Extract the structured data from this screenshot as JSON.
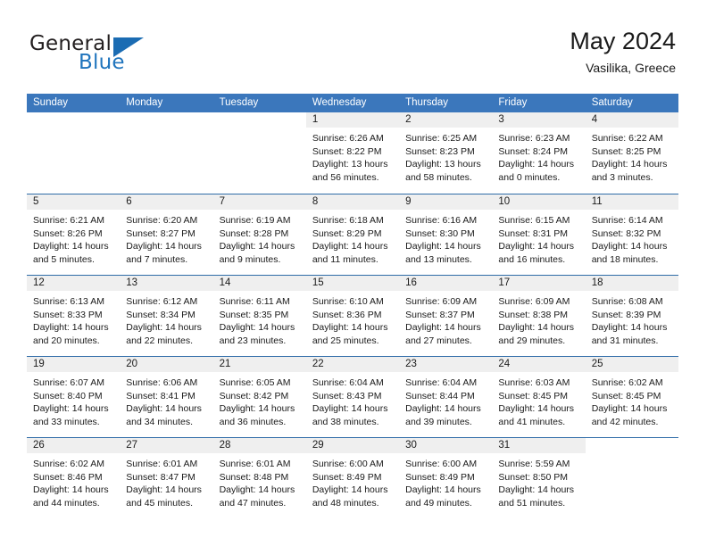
{
  "brand": {
    "name_part1": "General",
    "name_part2": "Blue",
    "flag_icon": "triangle-flag-icon"
  },
  "header": {
    "title": "May 2024",
    "subtitle": "Vasilika, Greece"
  },
  "colors": {
    "header_band": "#3b77bc",
    "row_divider": "#2f6ca8",
    "day_head_bg": "#efefef",
    "brand_blue": "#1f74bd",
    "text": "#1a1a1a"
  },
  "weekdays": [
    "Sunday",
    "Monday",
    "Tuesday",
    "Wednesday",
    "Thursday",
    "Friday",
    "Saturday"
  ],
  "weeks": [
    [
      {
        "day": "",
        "lines": []
      },
      {
        "day": "",
        "lines": []
      },
      {
        "day": "",
        "lines": []
      },
      {
        "day": "1",
        "lines": [
          "Sunrise: 6:26 AM",
          "Sunset: 8:22 PM",
          "Daylight: 13 hours",
          "and 56 minutes."
        ]
      },
      {
        "day": "2",
        "lines": [
          "Sunrise: 6:25 AM",
          "Sunset: 8:23 PM",
          "Daylight: 13 hours",
          "and 58 minutes."
        ]
      },
      {
        "day": "3",
        "lines": [
          "Sunrise: 6:23 AM",
          "Sunset: 8:24 PM",
          "Daylight: 14 hours",
          "and 0 minutes."
        ]
      },
      {
        "day": "4",
        "lines": [
          "Sunrise: 6:22 AM",
          "Sunset: 8:25 PM",
          "Daylight: 14 hours",
          "and 3 minutes."
        ]
      }
    ],
    [
      {
        "day": "5",
        "lines": [
          "Sunrise: 6:21 AM",
          "Sunset: 8:26 PM",
          "Daylight: 14 hours",
          "and 5 minutes."
        ]
      },
      {
        "day": "6",
        "lines": [
          "Sunrise: 6:20 AM",
          "Sunset: 8:27 PM",
          "Daylight: 14 hours",
          "and 7 minutes."
        ]
      },
      {
        "day": "7",
        "lines": [
          "Sunrise: 6:19 AM",
          "Sunset: 8:28 PM",
          "Daylight: 14 hours",
          "and 9 minutes."
        ]
      },
      {
        "day": "8",
        "lines": [
          "Sunrise: 6:18 AM",
          "Sunset: 8:29 PM",
          "Daylight: 14 hours",
          "and 11 minutes."
        ]
      },
      {
        "day": "9",
        "lines": [
          "Sunrise: 6:16 AM",
          "Sunset: 8:30 PM",
          "Daylight: 14 hours",
          "and 13 minutes."
        ]
      },
      {
        "day": "10",
        "lines": [
          "Sunrise: 6:15 AM",
          "Sunset: 8:31 PM",
          "Daylight: 14 hours",
          "and 16 minutes."
        ]
      },
      {
        "day": "11",
        "lines": [
          "Sunrise: 6:14 AM",
          "Sunset: 8:32 PM",
          "Daylight: 14 hours",
          "and 18 minutes."
        ]
      }
    ],
    [
      {
        "day": "12",
        "lines": [
          "Sunrise: 6:13 AM",
          "Sunset: 8:33 PM",
          "Daylight: 14 hours",
          "and 20 minutes."
        ]
      },
      {
        "day": "13",
        "lines": [
          "Sunrise: 6:12 AM",
          "Sunset: 8:34 PM",
          "Daylight: 14 hours",
          "and 22 minutes."
        ]
      },
      {
        "day": "14",
        "lines": [
          "Sunrise: 6:11 AM",
          "Sunset: 8:35 PM",
          "Daylight: 14 hours",
          "and 23 minutes."
        ]
      },
      {
        "day": "15",
        "lines": [
          "Sunrise: 6:10 AM",
          "Sunset: 8:36 PM",
          "Daylight: 14 hours",
          "and 25 minutes."
        ]
      },
      {
        "day": "16",
        "lines": [
          "Sunrise: 6:09 AM",
          "Sunset: 8:37 PM",
          "Daylight: 14 hours",
          "and 27 minutes."
        ]
      },
      {
        "day": "17",
        "lines": [
          "Sunrise: 6:09 AM",
          "Sunset: 8:38 PM",
          "Daylight: 14 hours",
          "and 29 minutes."
        ]
      },
      {
        "day": "18",
        "lines": [
          "Sunrise: 6:08 AM",
          "Sunset: 8:39 PM",
          "Daylight: 14 hours",
          "and 31 minutes."
        ]
      }
    ],
    [
      {
        "day": "19",
        "lines": [
          "Sunrise: 6:07 AM",
          "Sunset: 8:40 PM",
          "Daylight: 14 hours",
          "and 33 minutes."
        ]
      },
      {
        "day": "20",
        "lines": [
          "Sunrise: 6:06 AM",
          "Sunset: 8:41 PM",
          "Daylight: 14 hours",
          "and 34 minutes."
        ]
      },
      {
        "day": "21",
        "lines": [
          "Sunrise: 6:05 AM",
          "Sunset: 8:42 PM",
          "Daylight: 14 hours",
          "and 36 minutes."
        ]
      },
      {
        "day": "22",
        "lines": [
          "Sunrise: 6:04 AM",
          "Sunset: 8:43 PM",
          "Daylight: 14 hours",
          "and 38 minutes."
        ]
      },
      {
        "day": "23",
        "lines": [
          "Sunrise: 6:04 AM",
          "Sunset: 8:44 PM",
          "Daylight: 14 hours",
          "and 39 minutes."
        ]
      },
      {
        "day": "24",
        "lines": [
          "Sunrise: 6:03 AM",
          "Sunset: 8:45 PM",
          "Daylight: 14 hours",
          "and 41 minutes."
        ]
      },
      {
        "day": "25",
        "lines": [
          "Sunrise: 6:02 AM",
          "Sunset: 8:45 PM",
          "Daylight: 14 hours",
          "and 42 minutes."
        ]
      }
    ],
    [
      {
        "day": "26",
        "lines": [
          "Sunrise: 6:02 AM",
          "Sunset: 8:46 PM",
          "Daylight: 14 hours",
          "and 44 minutes."
        ]
      },
      {
        "day": "27",
        "lines": [
          "Sunrise: 6:01 AM",
          "Sunset: 8:47 PM",
          "Daylight: 14 hours",
          "and 45 minutes."
        ]
      },
      {
        "day": "28",
        "lines": [
          "Sunrise: 6:01 AM",
          "Sunset: 8:48 PM",
          "Daylight: 14 hours",
          "and 47 minutes."
        ]
      },
      {
        "day": "29",
        "lines": [
          "Sunrise: 6:00 AM",
          "Sunset: 8:49 PM",
          "Daylight: 14 hours",
          "and 48 minutes."
        ]
      },
      {
        "day": "30",
        "lines": [
          "Sunrise: 6:00 AM",
          "Sunset: 8:49 PM",
          "Daylight: 14 hours",
          "and 49 minutes."
        ]
      },
      {
        "day": "31",
        "lines": [
          "Sunrise: 5:59 AM",
          "Sunset: 8:50 PM",
          "Daylight: 14 hours",
          "and 51 minutes."
        ]
      },
      {
        "day": "",
        "lines": []
      }
    ]
  ]
}
